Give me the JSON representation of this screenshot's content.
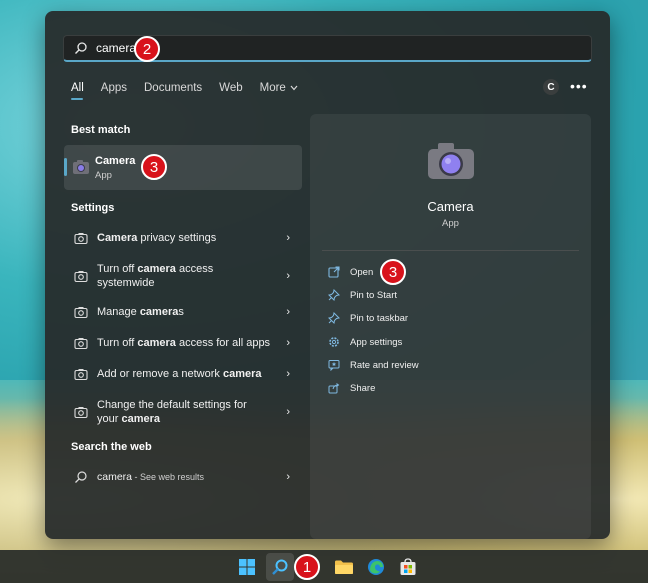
{
  "search": {
    "value": "camera",
    "placeholder": ""
  },
  "tabs": [
    {
      "label": "All"
    },
    {
      "label": "Apps"
    },
    {
      "label": "Documents"
    },
    {
      "label": "Web"
    },
    {
      "label": "More"
    }
  ],
  "account_initial": "C",
  "more_options": "•••",
  "sections": {
    "best_match": "Best match",
    "settings": "Settings",
    "search_web": "Search the web"
  },
  "best_match": {
    "name": "Camera",
    "type": "App"
  },
  "settings_items": [
    {
      "pre": "",
      "bold": "Camera",
      "post": " privacy settings"
    },
    {
      "pre": "Turn off ",
      "bold": "camera",
      "post": " access systemwide"
    },
    {
      "pre": "Manage ",
      "bold": "camera",
      "post": "s"
    },
    {
      "pre": "Turn off ",
      "bold": "camera",
      "post": " access for all apps"
    },
    {
      "pre": "Add or remove a network ",
      "bold": "camera",
      "post": ""
    },
    {
      "pre": "Change the default settings for your ",
      "bold": "camera",
      "post": ""
    }
  ],
  "web_result": {
    "query": "camera",
    "suffix": " - See web results"
  },
  "preview": {
    "title": "Camera",
    "type": "App",
    "actions": [
      {
        "label": "Open",
        "icon": "open-external-icon"
      },
      {
        "label": "Pin to Start",
        "icon": "pin-icon"
      },
      {
        "label": "Pin to taskbar",
        "icon": "pin-icon"
      },
      {
        "label": "App settings",
        "icon": "gear-icon"
      },
      {
        "label": "Rate and review",
        "icon": "star-review-icon"
      },
      {
        "label": "Share",
        "icon": "share-icon"
      }
    ]
  },
  "badges": {
    "taskbar_search": "1",
    "search_box": "2",
    "best_match": "3",
    "open": "3"
  },
  "colors": {
    "accent": "#5aa7c8",
    "badge": "#d8121b",
    "panel": "#262a2a"
  }
}
